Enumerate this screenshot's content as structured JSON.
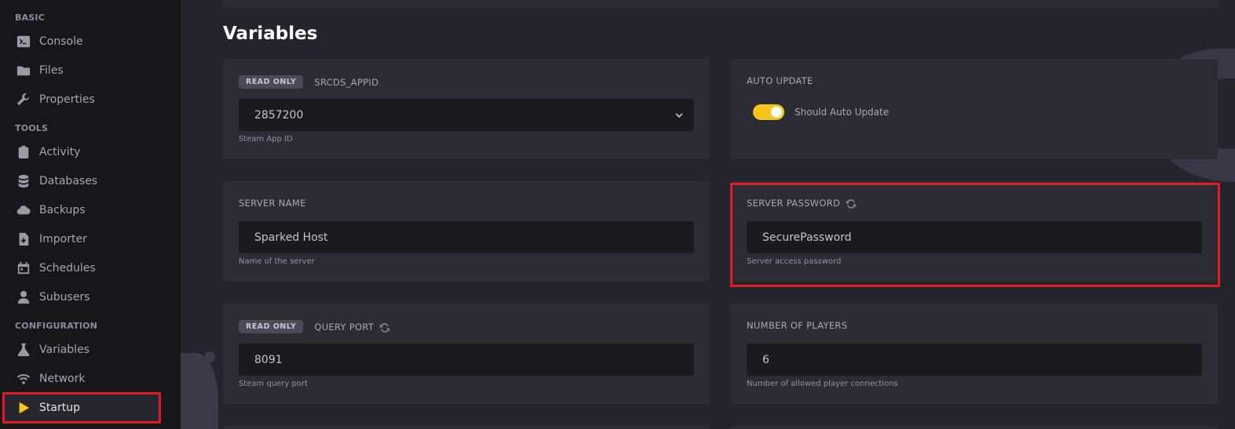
{
  "sidebar": {
    "sections": {
      "basic": "BASIC",
      "tools": "TOOLS",
      "configuration": "CONFIGURATION"
    },
    "items": {
      "console": "Console",
      "files": "Files",
      "properties": "Properties",
      "activity": "Activity",
      "databases": "Databases",
      "backups": "Backups",
      "importer": "Importer",
      "schedules": "Schedules",
      "subusers": "Subusers",
      "variables": "Variables",
      "network": "Network",
      "startup": "Startup"
    },
    "active": "startup"
  },
  "main": {
    "title": "Variables",
    "cards": {
      "appid": {
        "badge": "READ ONLY",
        "label": "SRCDS_APPID",
        "value": "2857200",
        "hint": "Steam App ID"
      },
      "auto_update": {
        "label": "AUTO UPDATE",
        "toggle_label": "Should Auto Update",
        "enabled": true
      },
      "server_name": {
        "label": "SERVER NAME",
        "value": "Sparked Host",
        "hint": "Name of the server"
      },
      "server_password": {
        "label": "SERVER PASSWORD",
        "value": "SecurePassword",
        "hint": "Server access password"
      },
      "query_port": {
        "badge": "READ ONLY",
        "label": "QUERY PORT",
        "value": "8091",
        "hint": "Steam query port"
      },
      "players": {
        "label": "NUMBER OF PLAYERS",
        "value": "6",
        "hint": "Number of allowed player connections"
      }
    }
  },
  "colors": {
    "accent": "#f5c518",
    "highlight": "#e01b24",
    "background": "#24242c",
    "sidebar": "#16161b",
    "card": "#2c2c35"
  }
}
